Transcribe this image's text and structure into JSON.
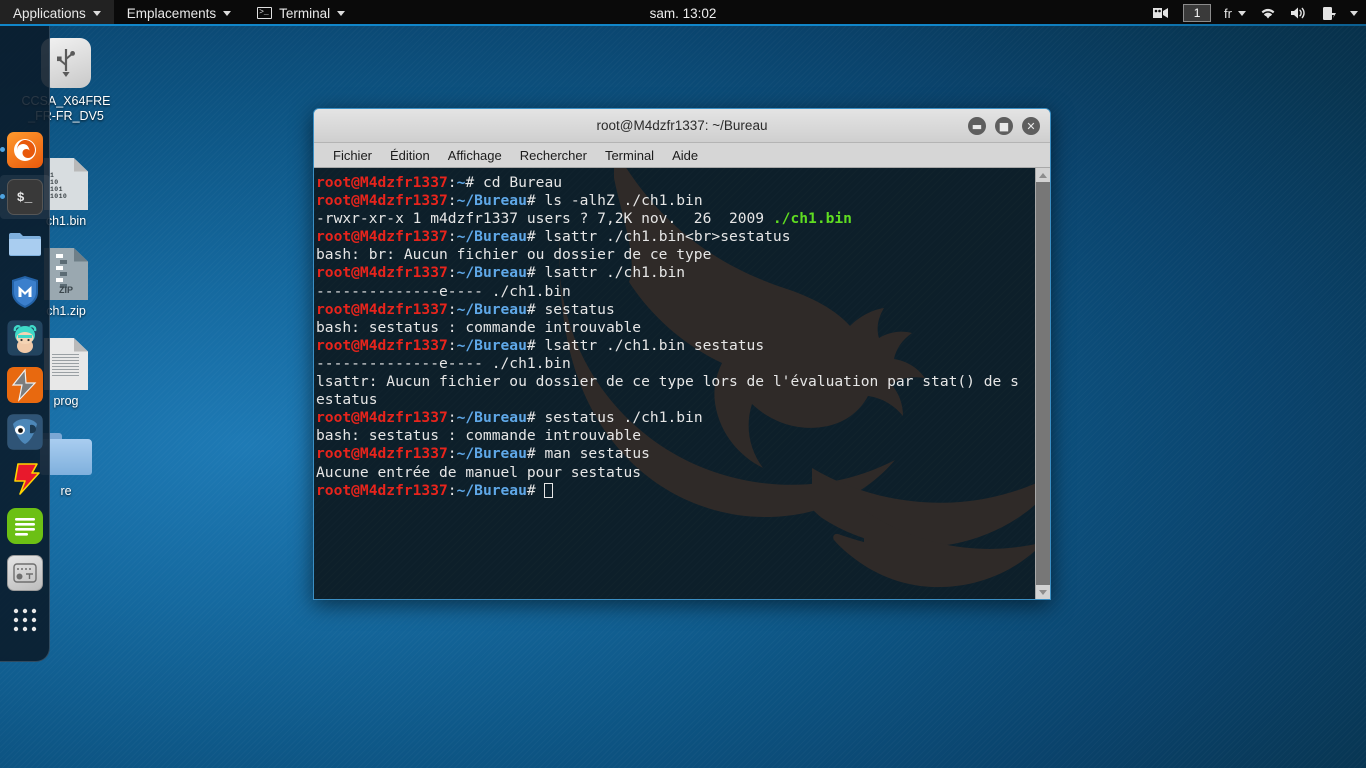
{
  "top_panel": {
    "menus": [
      {
        "label": "Applications",
        "icon": "chevron-down-icon"
      },
      {
        "label": "Emplacements",
        "icon": "chevron-down-icon"
      },
      {
        "label": "Terminal",
        "icon": "terminal-icon"
      }
    ],
    "clock": "sam. 13:02",
    "tray": {
      "screencast_icon": "screencast-icon",
      "workspace": "1",
      "language": "fr",
      "wifi_icon": "wifi-icon",
      "volume_icon": "volume-icon",
      "battery_icon": "battery-icon",
      "menu_icon": "chevron-down-icon"
    }
  },
  "dock": {
    "items": [
      {
        "name": "firefox",
        "running": true
      },
      {
        "name": "terminal",
        "running": true
      },
      {
        "name": "files",
        "running": false
      },
      {
        "name": "metasploit",
        "running": false
      },
      {
        "name": "armitage",
        "running": false
      },
      {
        "name": "zenmap",
        "running": false
      },
      {
        "name": "burpsuite",
        "running": false
      },
      {
        "name": "beef",
        "running": false
      },
      {
        "name": "text-editor",
        "running": false
      },
      {
        "name": "settings",
        "running": false
      },
      {
        "name": "show-applications",
        "running": false
      }
    ]
  },
  "desktop_icons": [
    {
      "label": "CCSA_X64FRE_FR-FR_DV5",
      "type": "usb-drive"
    },
    {
      "label": "ch1.bin",
      "type": "binary-file"
    },
    {
      "label": "ch1.zip",
      "type": "zip-archive"
    },
    {
      "label": "prog",
      "type": "text-document"
    },
    {
      "label": "re",
      "type": "folder"
    }
  ],
  "terminal_window": {
    "title": "root@M4dzfr1337: ~/Bureau",
    "window_buttons": {
      "minimize": "minimize-icon",
      "maximize": "maximize-icon",
      "close": "close-icon"
    },
    "menu_bar": [
      "Fichier",
      "Édition",
      "Affichage",
      "Rechercher",
      "Terminal",
      "Aide"
    ],
    "prompt_user": "root@M4dzfr1337",
    "lines": [
      {
        "type": "prompt",
        "user": "root@M4dzfr1337",
        "sep": ":",
        "path": "~",
        "tail": "# ",
        "cmd": "cd Bureau"
      },
      {
        "type": "prompt",
        "user": "root@M4dzfr1337",
        "sep": ":",
        "path": "~/Bureau",
        "tail": "# ",
        "cmd": "ls -alhZ ./ch1.bin"
      },
      {
        "type": "out_green_tail",
        "text": "-rwxr-xr-x 1 m4dzfr1337 users ? 7,2K nov.  26  2009 ",
        "green": "./ch1.bin"
      },
      {
        "type": "prompt",
        "user": "root@M4dzfr1337",
        "sep": ":",
        "path": "~/Bureau",
        "tail": "# ",
        "cmd": "lsattr ./ch1.bin<br>sestatus"
      },
      {
        "type": "out",
        "text": "bash: br: Aucun fichier ou dossier de ce type"
      },
      {
        "type": "prompt",
        "user": "root@M4dzfr1337",
        "sep": ":",
        "path": "~/Bureau",
        "tail": "# ",
        "cmd": "lsattr ./ch1.bin"
      },
      {
        "type": "out",
        "text": "--------------e---- ./ch1.bin"
      },
      {
        "type": "prompt",
        "user": "root@M4dzfr1337",
        "sep": ":",
        "path": "~/Bureau",
        "tail": "# ",
        "cmd": "sestatus"
      },
      {
        "type": "out",
        "text": "bash: sestatus : commande introuvable"
      },
      {
        "type": "prompt",
        "user": "root@M4dzfr1337",
        "sep": ":",
        "path": "~/Bureau",
        "tail": "# ",
        "cmd": "lsattr ./ch1.bin sestatus"
      },
      {
        "type": "out",
        "text": "--------------e---- ./ch1.bin"
      },
      {
        "type": "out",
        "text": "lsattr: Aucun fichier ou dossier de ce type lors de l'évaluation par stat() de s"
      },
      {
        "type": "out",
        "text": "estatus"
      },
      {
        "type": "prompt",
        "user": "root@M4dzfr1337",
        "sep": ":",
        "path": "~/Bureau",
        "tail": "# ",
        "cmd": "sestatus ./ch1.bin"
      },
      {
        "type": "out",
        "text": "bash: sestatus : commande introuvable"
      },
      {
        "type": "prompt",
        "user": "root@M4dzfr1337",
        "sep": ":",
        "path": "~/Bureau",
        "tail": "# ",
        "cmd": "man sestatus"
      },
      {
        "type": "out",
        "text": "Aucune entrée de manuel pour sestatus"
      },
      {
        "type": "prompt_cursor",
        "user": "root@M4dzfr1337",
        "sep": ":",
        "path": "~/Bureau",
        "tail": "# ",
        "cmd": ""
      }
    ]
  },
  "colors": {
    "prompt_user": "#e8241c",
    "prompt_path": "#5fa8e8",
    "green_file": "#5fdd21",
    "terminal_bg": "#0d1f2a",
    "panel_bg": "#0a0a0a",
    "accent": "#1186c9"
  }
}
